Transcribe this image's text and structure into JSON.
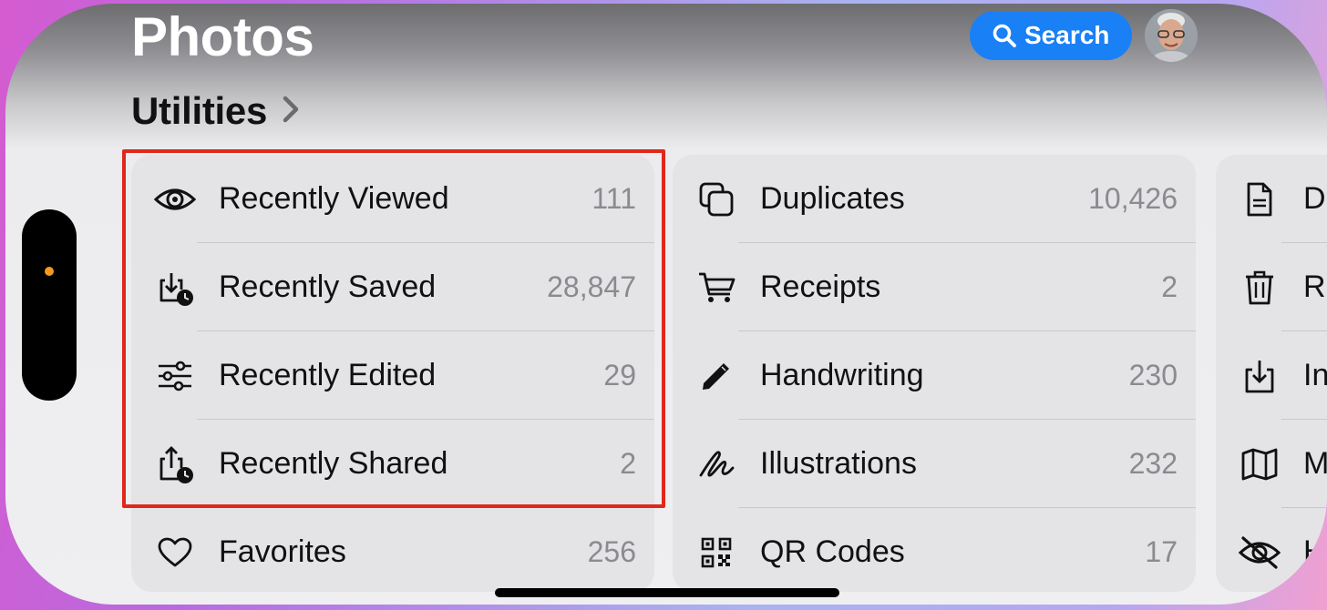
{
  "app": {
    "title": "Photos"
  },
  "header": {
    "search_label": "Search"
  },
  "section": {
    "title": "Utilities"
  },
  "column1": [
    {
      "label": "Recently Viewed",
      "count": "111",
      "icon": "eye-icon"
    },
    {
      "label": "Recently Saved",
      "count": "28,847",
      "icon": "download-clock-icon"
    },
    {
      "label": "Recently Edited",
      "count": "29",
      "icon": "sliders-icon"
    },
    {
      "label": "Recently Shared",
      "count": "2",
      "icon": "share-clock-icon"
    },
    {
      "label": "Favorites",
      "count": "256",
      "icon": "heart-icon"
    }
  ],
  "column2": [
    {
      "label": "Duplicates",
      "count": "10,426",
      "icon": "duplicate-icon"
    },
    {
      "label": "Receipts",
      "count": "2",
      "icon": "cart-icon"
    },
    {
      "label": "Handwriting",
      "count": "230",
      "icon": "pencil-icon"
    },
    {
      "label": "Illustrations",
      "count": "232",
      "icon": "scribble-icon"
    },
    {
      "label": "QR Codes",
      "count": "17",
      "icon": "qr-code-icon"
    }
  ],
  "column3": [
    {
      "label": "D",
      "icon": "document-icon"
    },
    {
      "label": "R",
      "icon": "trash-icon"
    },
    {
      "label": "In",
      "icon": "import-icon"
    },
    {
      "label": "M",
      "icon": "map-icon"
    },
    {
      "label": "H",
      "icon": "eye-slash-icon"
    }
  ],
  "colors": {
    "accent": "#1a80f5",
    "highlight": "#e0271b",
    "dot": "#f59a1a"
  }
}
